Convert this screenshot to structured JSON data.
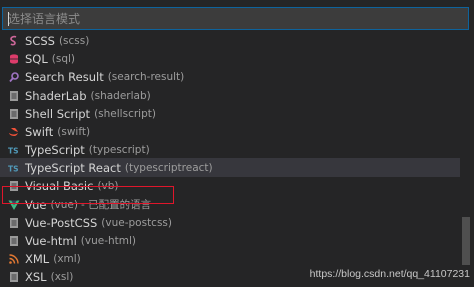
{
  "search": {
    "placeholder": "选择语言模式"
  },
  "items": [
    {
      "label": "SCSS",
      "desc": "(scss)",
      "icon": "sass-icon",
      "color": "#cd6799"
    },
    {
      "label": "SQL",
      "desc": "(sql)",
      "icon": "database-icon",
      "color": "#dd3c6b"
    },
    {
      "label": "Search Result",
      "desc": "(search-result)",
      "icon": "search-icon",
      "color": "#a074c4"
    },
    {
      "label": "ShaderLab",
      "desc": "(shaderlab)",
      "icon": "file-icon",
      "color": "#9a9a9a"
    },
    {
      "label": "Shell Script",
      "desc": "(shellscript)",
      "icon": "file-icon",
      "color": "#9a9a9a"
    },
    {
      "label": "Swift",
      "desc": "(swift)",
      "icon": "swift-icon",
      "color": "#f05138"
    },
    {
      "label": "TypeScript",
      "desc": "(typescript)",
      "icon": "typescript-icon",
      "color": "#519aba"
    },
    {
      "label": "TypeScript React",
      "desc": "(typescriptreact)",
      "icon": "typescript-icon",
      "color": "#519aba"
    },
    {
      "label": "Visual Basic",
      "desc": "(vb)",
      "icon": "file-icon",
      "color": "#9a9a9a"
    },
    {
      "label": "Vue",
      "desc": "(vue)",
      "extra": "- 已配置的语言",
      "icon": "vue-icon",
      "color": "#41b883"
    },
    {
      "label": "Vue-PostCSS",
      "desc": "(vue-postcss)",
      "icon": "file-icon",
      "color": "#9a9a9a"
    },
    {
      "label": "Vue-html",
      "desc": "(vue-html)",
      "icon": "file-icon",
      "color": "#9a9a9a"
    },
    {
      "label": "XML",
      "desc": "(xml)",
      "icon": "rss-icon",
      "color": "#e37933"
    },
    {
      "label": "XSL",
      "desc": "(xsl)",
      "icon": "file-icon",
      "color": "#9a9a9a"
    }
  ],
  "focused_index": 7,
  "watermark": "https://blog.csdn.net/qq_41107231",
  "colors": {
    "background": "#252526",
    "focus_border": "#0e639c",
    "highlight": "#e0162b"
  }
}
